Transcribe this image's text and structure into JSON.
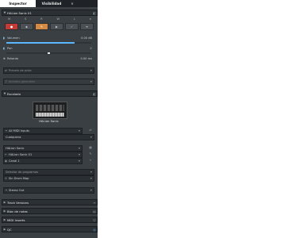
{
  "tabs": [
    {
      "label": "Inspector"
    },
    {
      "label": "Visibilidad"
    },
    {
      "label": "×"
    }
  ],
  "track": {
    "name": "HALion Sonic 01",
    "controls": [
      {
        "label": "M",
        "state": "off"
      },
      {
        "label": "S",
        "state": "off"
      },
      {
        "label": "R",
        "state": "off"
      },
      {
        "label": "W",
        "state": "on"
      },
      {
        "label": "L",
        "state": "off"
      },
      {
        "label": "e",
        "state": "off"
      }
    ],
    "volume": {
      "label": "Volumen",
      "value": "0.00 dB"
    },
    "pan": {
      "label": "Pan",
      "value": "C"
    },
    "delay": {
      "label": "Retardo",
      "value": "0.00 ms"
    }
  },
  "preset_field": {
    "placeholder": "Presets de pista"
  },
  "chord_field": {
    "label": "Acordes generales"
  },
  "sections": {
    "instrument": {
      "title": "Escalado",
      "plugin": "HALion Sonic"
    },
    "track_versions": "Track Versions",
    "notepad": "Bloc de notas",
    "midi_inserts": "MIDI Inserts",
    "qc": "QC"
  },
  "routing": {
    "input": "All MIDI Inputs",
    "channel_any": "Cualquiera",
    "output_device": "HALion Sonic",
    "output_name": "HALion Sonic 01",
    "channel": "Canal 1",
    "program_selector": "Selector de programas",
    "drum_map": "Sin Drum Map",
    "stereo_out": "Stereo Out"
  },
  "colors": {
    "accent": "#5ab7ff",
    "record": "#c33a36",
    "write": "#d58a44",
    "panel": "#3a3f44"
  }
}
